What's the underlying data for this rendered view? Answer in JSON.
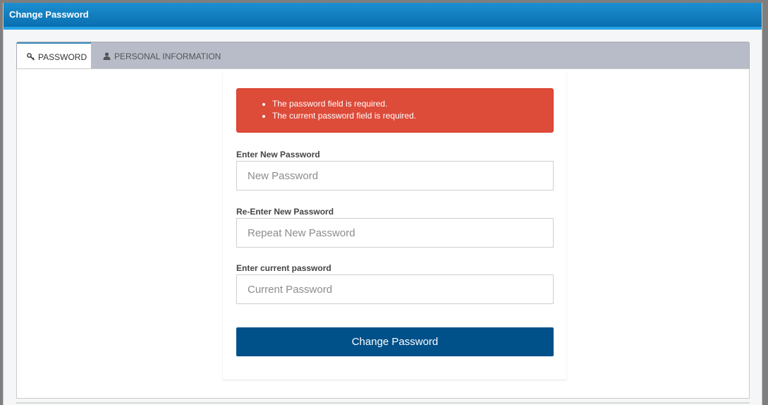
{
  "window": {
    "title": "Change Password"
  },
  "tabs": [
    {
      "label": "PASSWORD",
      "icon": "key-icon",
      "active": true
    },
    {
      "label": "PERSONAL INFORMATION",
      "icon": "user-icon",
      "active": false
    }
  ],
  "alert": {
    "color": "#dd4b39",
    "errors": [
      "The password field is required.",
      "The current password field is required."
    ]
  },
  "form": {
    "new_password": {
      "label": "Enter New Password",
      "placeholder": "New Password",
      "value": ""
    },
    "repeat_password": {
      "label": "Re-Enter New Password",
      "placeholder": "Repeat New Password",
      "value": ""
    },
    "current_password": {
      "label": "Enter current password",
      "placeholder": "Current Password",
      "value": ""
    },
    "submit_label": "Change Password",
    "submit_color": "#00508a"
  },
  "colors": {
    "titlebar": "#0a6fb0",
    "tab_accent": "#3c8dbc"
  }
}
